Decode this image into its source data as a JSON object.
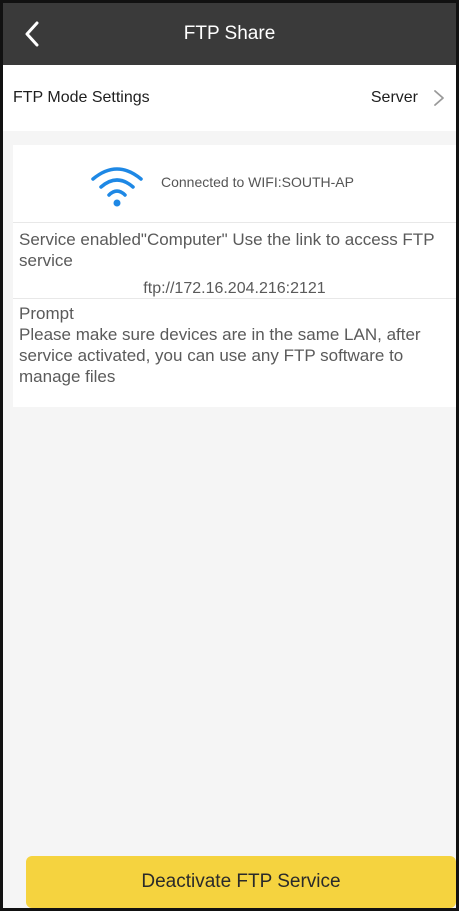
{
  "header": {
    "title": "FTP Share",
    "back_icon": "chevron-left-icon"
  },
  "mode_settings": {
    "label": "FTP Mode Settings",
    "value": "Server",
    "chevron_icon": "chevron-right-icon"
  },
  "connection": {
    "wifi_icon": "wifi-icon",
    "status_text": "Connected to WIFI:SOUTH-AP",
    "service_text": "Service enabled\"Computer\" Use the link to access FTP service",
    "ftp_url": "ftp://172.16.204.216:2121"
  },
  "prompt": {
    "title": "Prompt",
    "body": "Please make sure devices are in the same LAN, after service activated, you can use any FTP software to manage files"
  },
  "action": {
    "deactivate_label": "Deactivate FTP Service"
  },
  "colors": {
    "header_bg": "#3a3a3a",
    "accent_button": "#f5d33f",
    "wifi_blue": "#1e88e5"
  }
}
